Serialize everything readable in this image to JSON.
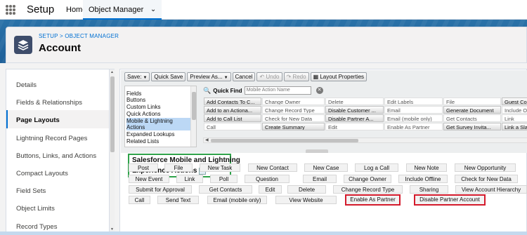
{
  "nav": {
    "app_title": "Setup",
    "tabs": [
      {
        "label": "Home"
      },
      {
        "label": "Object Manager"
      }
    ]
  },
  "header": {
    "breadcrumb": "SETUP > OBJECT MANAGER",
    "title": "Account"
  },
  "sidebar": {
    "items": [
      {
        "label": "Details"
      },
      {
        "label": "Fields & Relationships"
      },
      {
        "label": "Page Layouts"
      },
      {
        "label": "Lightning Record Pages"
      },
      {
        "label": "Buttons, Links, and Actions"
      },
      {
        "label": "Compact Layouts"
      },
      {
        "label": "Field Sets"
      },
      {
        "label": "Object Limits"
      },
      {
        "label": "Record Types"
      }
    ],
    "active": "Page Layouts"
  },
  "toolbar": {
    "save": "Save:",
    "quick_save": "Quick Save",
    "preview_as": "Preview As...",
    "cancel": "Cancel",
    "undo": "Undo",
    "redo": "Redo",
    "layout_properties": "Layout Properties"
  },
  "palette": {
    "categories": [
      "Fields",
      "Buttons",
      "Custom Links",
      "Quick Actions",
      "Mobile & Lightning Actions",
      "Expanded Lookups",
      "Related Lists"
    ],
    "selected_category": "Mobile & Lightning Actions",
    "quick_find_label": "Quick Find",
    "quick_find_placeholder": "Mobile Action Name",
    "rows": [
      [
        "Add Contacts To C...",
        "Change Owner",
        "Delete",
        "Edit Labels",
        "File",
        "Guest Com"
      ],
      [
        "Add to an Actiona...",
        "Change Record Type",
        "Disable Customer ...",
        "Email",
        "Generate Document",
        "Include Offl"
      ],
      [
        "Add to Call List",
        "Check for New Data",
        "Disable Partner A...",
        "Email (mobile only)",
        "Get Contacts",
        "Link"
      ],
      [
        "Call",
        "Create Summary",
        "Edit",
        "Enable As Partner",
        "Get Survey Invita...",
        "Link a Slack"
      ]
    ]
  },
  "section": {
    "title_line1": "Salesforce Mobile and Lightning",
    "title_line2": "Experience Actions",
    "info_glyph": "i"
  },
  "actions": {
    "row1": [
      "Post",
      "File",
      "New Task",
      "New Contact",
      "New Case",
      "Log a Call",
      "New Note",
      "New Opportunity"
    ],
    "row2": [
      "New Event",
      "Link",
      "Poll",
      "Question",
      "Email",
      "Change Owner",
      "Include Offline",
      "Check for New Data"
    ],
    "row3": [
      "Submit for Approval",
      "Get Contacts",
      "Edit",
      "Delete",
      "Change Record Type",
      "Sharing",
      "View Account Hierarchy"
    ],
    "row4": [
      "Call",
      "Send Text",
      "Email (mobile only)",
      "View Website",
      "Enable As Partner",
      "Disable Partner Account"
    ]
  },
  "colors": {
    "accent": "#0070d2",
    "header_band": "#2a72a8",
    "highlight_green": "#2fa24a",
    "highlight_red": "#d41b2c"
  }
}
